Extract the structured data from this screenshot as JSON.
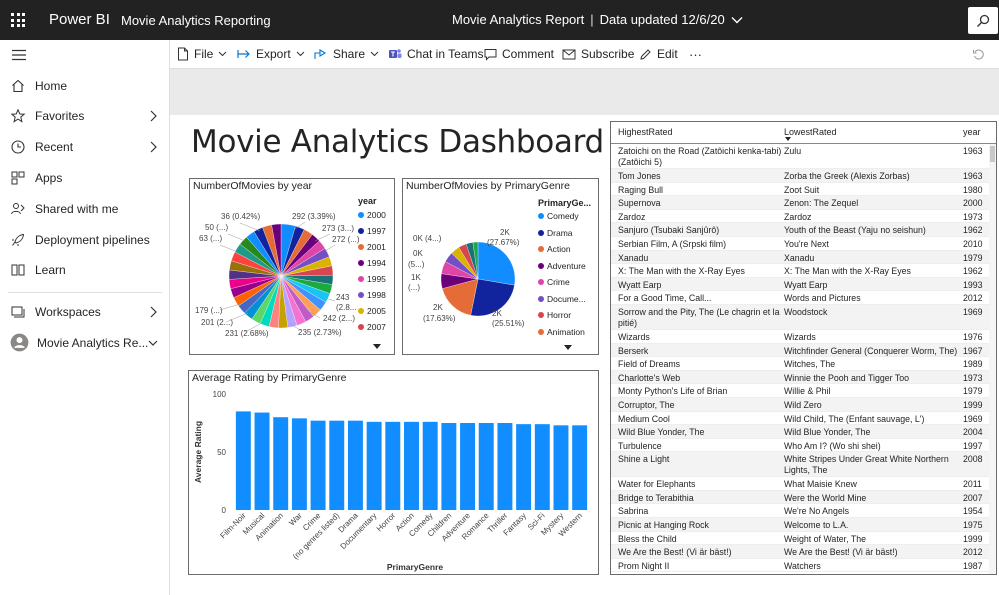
{
  "topbar": {
    "app_name": "Power BI",
    "workspace": "Movie Analytics Reporting",
    "report_title": "Movie Analytics Report",
    "separator": "|",
    "data_updated": "Data updated 12/6/20"
  },
  "nav": {
    "items": [
      {
        "label": "Home",
        "icon": "home-icon"
      },
      {
        "label": "Favorites",
        "icon": "star-icon"
      },
      {
        "label": "Recent",
        "icon": "clock-icon"
      },
      {
        "label": "Apps",
        "icon": "apps-icon"
      },
      {
        "label": "Shared with me",
        "icon": "shared-icon"
      },
      {
        "label": "Deployment pipelines",
        "icon": "rocket-icon"
      },
      {
        "label": "Learn",
        "icon": "book-icon"
      },
      {
        "label": "Workspaces",
        "icon": "workspaces-icon"
      },
      {
        "label": "Movie Analytics Re...",
        "icon": "workspace-avatar-icon"
      }
    ]
  },
  "cmdbar": {
    "file": "File",
    "export": "Export",
    "share": "Share",
    "teams": "Chat in Teams",
    "comment": "Comment",
    "subscribe": "Subscribe",
    "edit": "Edit",
    "more": "···"
  },
  "dashboard": {
    "title": "Movie Analytics Dashboard"
  },
  "pie_year": {
    "title": "NumberOfMovies by year",
    "legend_title": "year",
    "legend": [
      "2000",
      "1997",
      "2001",
      "1994",
      "1995",
      "1998",
      "2005",
      "2007"
    ],
    "labels": [
      "36 (0.42%)",
      "292 (3.39%)",
      "50 (...)",
      "273 (3...)",
      "63 (...)",
      "272 (...)",
      "243",
      "(2.8...",
      "179 (...)",
      "242 (2...)",
      "201 (2...)",
      "231 (2.68%)",
      "235 (2.73%)"
    ]
  },
  "pie_genre": {
    "title": "NumberOfMovies by PrimaryGenre",
    "legend_title": "PrimaryGe...",
    "legend": [
      "Comedy",
      "Drama",
      "Action",
      "Adventure",
      "Crime",
      "Docume...",
      "Horror",
      "Animation"
    ],
    "labels": [
      "0K (4...)",
      "0K",
      "(5...)",
      "1K",
      "(...)",
      "2K",
      "(27.67%)",
      "2K",
      "(17.63%)",
      "2K",
      "(25.51%)"
    ]
  },
  "chart_data": {
    "type": "bar",
    "title": "Average Rating by PrimaryGenre",
    "xlabel": "PrimaryGenre",
    "ylabel": "Average Rating",
    "ylim": [
      0,
      100
    ],
    "yticks": [
      "100",
      "50",
      "0"
    ],
    "categories": [
      "Film-Noir",
      "Musical",
      "Animation",
      "War",
      "Crime",
      "(no genres listed)",
      "Drama",
      "Documentary",
      "Horror",
      "Action",
      "Comedy",
      "Children",
      "Adventure",
      "Romance",
      "Thriller",
      "Fantasy",
      "Sci-Fi",
      "Mystery",
      "Western"
    ],
    "values": [
      85,
      84,
      80,
      79,
      77,
      77,
      77,
      76,
      76,
      76,
      76,
      75,
      75,
      75,
      75,
      74,
      74,
      73,
      73
    ],
    "color": "#118DFF"
  },
  "pie_colors": {
    "year": [
      "#118DFF",
      "#12239E",
      "#E66C37",
      "#6B007B",
      "#E044A7",
      "#744EC2",
      "#D9B300",
      "#D64550",
      "#197278",
      "#1AAB40",
      "#15C6F4",
      "#4092FF",
      "#FFA058",
      "#BE5DC9",
      "#F472D0",
      "#B5A1FF",
      "#C4A200",
      "#FF8080",
      "#00DBBC",
      "#5BD667",
      "#0091D5",
      "#4668C5",
      "#FF6300",
      "#99008A",
      "#EC008C",
      "#533285",
      "#99700A",
      "#FF4141",
      "#1F9A85",
      "#25891C"
    ],
    "genre": [
      "#118DFF",
      "#12239E",
      "#E66C37",
      "#6B007B",
      "#E044A7",
      "#744EC2",
      "#D9B300",
      "#D64550",
      "#197278",
      "#1AAB40"
    ]
  },
  "table": {
    "headers": [
      "HighestRated",
      "LowestRated",
      "year"
    ],
    "rows": [
      [
        "Zatoichi on the Road (Zatôichi kenka-tabi) (Zatôichi 5)",
        "Zulu",
        "1963"
      ],
      [
        "Tom Jones",
        "Zorba the Greek (Alexis Zorbas)",
        "1963"
      ],
      [
        "Raging Bull",
        "Zoot Suit",
        "1980"
      ],
      [
        "Supernova",
        "Zenon: The Zequel",
        "2000"
      ],
      [
        "Zardoz",
        "Zardoz",
        "1973"
      ],
      [
        "Sanjuro (Tsubaki Sanjûrô)",
        "Youth of the Beast (Yaju no seishun)",
        "1962"
      ],
      [
        "Serbian Film, A (Srpski film)",
        "You're Next",
        "2010"
      ],
      [
        "Xanadu",
        "Xanadu",
        "1979"
      ],
      [
        "X: The Man with the X-Ray Eyes",
        "X: The Man with the X-Ray Eyes",
        "1962"
      ],
      [
        "Wyatt Earp",
        "Wyatt Earp",
        "1993"
      ],
      [
        "For a Good Time, Call...",
        "Words and Pictures",
        "2012"
      ],
      [
        "Sorrow and the Pity, The (Le chagrin et la pitié)",
        "Woodstock",
        "1969"
      ],
      [
        "Wizards",
        "Wizards",
        "1976"
      ],
      [
        "Berserk",
        "Witchfinder General (Conquerer Worm, The)",
        "1967"
      ],
      [
        "Field of Dreams",
        "Witches, The",
        "1989"
      ],
      [
        "Charlotte's Web",
        "Winnie the Pooh and Tigger Too",
        "1973"
      ],
      [
        "Monty Python's Life of Brian",
        "Willie & Phil",
        "1979"
      ],
      [
        "Corruptor, The",
        "Wild Zero",
        "1999"
      ],
      [
        "Medium Cool",
        "Wild Child, The (Enfant sauvage, L')",
        "1969"
      ],
      [
        "Wild Blue Yonder, The",
        "Wild Blue Yonder, The",
        "2004"
      ],
      [
        "Turbulence",
        "Who Am I? (Wo shi shei)",
        "1997"
      ],
      [
        "Shine a Light",
        "White Stripes Under Great White Northern Lights, The",
        "2008"
      ],
      [
        "Water for Elephants",
        "What Maisie Knew",
        "2011"
      ],
      [
        "Bridge to Terabithia",
        "Were the World Mine",
        "2007"
      ],
      [
        "Sabrina",
        "We're No Angels",
        "1954"
      ],
      [
        "Picnic at Hanging Rock",
        "Welcome to L.A.",
        "1975"
      ],
      [
        "Bless the Child",
        "Weight of Water, The",
        "1999"
      ],
      [
        "We Are the Best! (Vi är bäst!)",
        "We Are the Best! (Vi är bäst!)",
        "2012"
      ],
      [
        "Prom Night II",
        "Watchers",
        "1987"
      ]
    ]
  }
}
